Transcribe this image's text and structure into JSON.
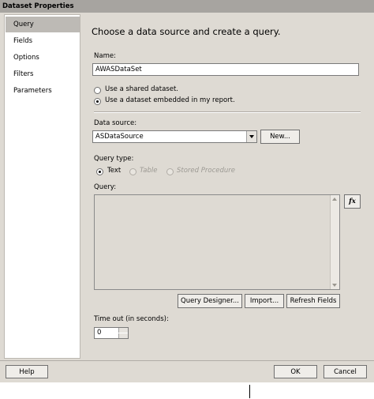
{
  "window": {
    "title": "Dataset Properties"
  },
  "nav": {
    "items": [
      "Query",
      "Fields",
      "Options",
      "Filters",
      "Parameters"
    ],
    "selected": "Query"
  },
  "main": {
    "heading": "Choose a data source and create a query.",
    "name_label": "Name:",
    "name_value": "AWASDataSet",
    "radio_shared": "Use a shared dataset.",
    "radio_embedded": "Use a dataset embedded in my report.",
    "datasource_label": "Data source:",
    "datasource_value": "ASDataSource",
    "new_button": "New...",
    "querytype_label": "Query type:",
    "qt_text": "Text",
    "qt_table": "Table",
    "qt_stored": "Stored Procedure",
    "query_label": "Query:",
    "query_value": "",
    "fx_button": "fx",
    "query_designer_button": "Query Designer...",
    "import_button": "Import...",
    "refresh_button": "Refresh Fields",
    "timeout_label": "Time out (in seconds):",
    "timeout_value": "0"
  },
  "footer": {
    "help": "Help",
    "ok": "OK",
    "cancel": "Cancel"
  }
}
